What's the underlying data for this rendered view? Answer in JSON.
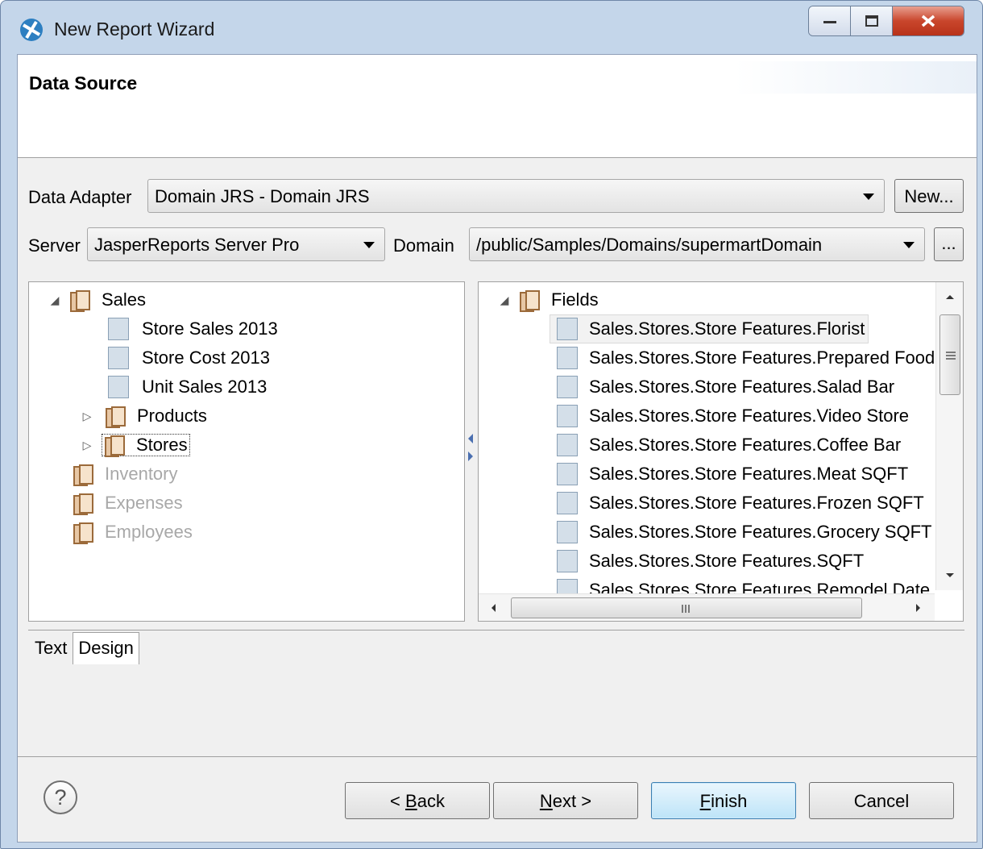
{
  "window": {
    "title": "New Report Wizard",
    "minimize_icon": "minimize-icon",
    "maximize_icon": "maximize-icon",
    "close_icon": "close-icon"
  },
  "header": {
    "title": "Data Source"
  },
  "data_adapter": {
    "label": "Data Adapter",
    "value": "Domain JRS - Domain JRS",
    "new_button": "New..."
  },
  "server": {
    "label": "Server",
    "value": "JasperReports Server Pro"
  },
  "domain": {
    "label": "Domain",
    "value": "/public/Samples/Domains/supermartDomain",
    "browse_button": "..."
  },
  "left_tree": {
    "root": "Sales",
    "items": [
      "Store Sales 2013",
      "Store Cost 2013",
      "Unit Sales 2013"
    ],
    "subfolders": [
      "Products",
      "Stores"
    ],
    "disabled_folders": [
      "Inventory",
      "Expenses",
      "Employees"
    ]
  },
  "right_tree": {
    "root": "Fields",
    "items": [
      "Sales.Stores.Store Features.Florist",
      "Sales.Stores.Store Features.Prepared Food",
      "Sales.Stores.Store Features.Salad Bar",
      "Sales.Stores.Store Features.Video Store",
      "Sales.Stores.Store Features.Coffee Bar",
      "Sales.Stores.Store Features.Meat SQFT",
      "Sales.Stores.Store Features.Frozen SQFT",
      "Sales.Stores.Store Features.Grocery SQFT",
      "Sales.Stores.Store Features.SQFT",
      "Sales.Stores.Store Features.Remodel Date"
    ]
  },
  "tabs": [
    "Text",
    "Design"
  ],
  "buttons": {
    "help": "?",
    "back": "< Back",
    "next": "Next >",
    "finish": "Finish",
    "cancel": "Cancel"
  }
}
